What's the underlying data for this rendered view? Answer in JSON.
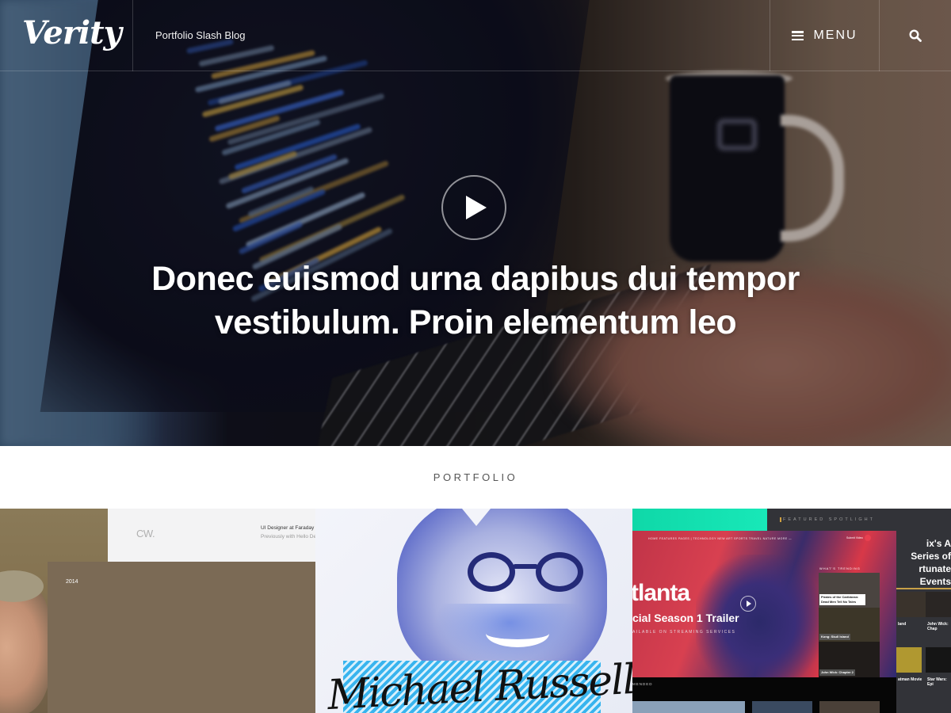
{
  "header": {
    "logo": "Verity",
    "tagline": "Portfolio Slash Blog",
    "menu_label": "MENU",
    "menu_icon": "hamburger-icon",
    "search_icon": "search-icon"
  },
  "hero": {
    "play_icon": "play-icon",
    "title": "Donec euismod urna dapibus dui tempor vestibulum. Proin elementum leo"
  },
  "portfolio": {
    "section_label": "PORTFOLIO",
    "items": [
      {
        "logo_text": "CW.",
        "role": "UI Designer at Faraday I",
        "previously": "Previously with Hello De",
        "year": "2014"
      },
      {
        "signature": "Michael Russell"
      },
      {
        "featured_label": "FEATURED SPOTLIGHT",
        "featured_headline_1": "ix's A Series of",
        "featured_headline_2": "rtunate Events",
        "nav": "HOME   FEATURES   PAGES   |   TECHNOLOGY   NEW   ART   SPORTS   TRAVEL   NATURE   MORE —",
        "submit_label": "Submit Video",
        "title": "tlanta",
        "subtitle": "cial Season 1 Trailer",
        "availability": "AILABLE ON STREAMING SERVICES",
        "trending_label": "WHAT'S TRENDING",
        "trending": [
          "Pirates of the Caribbean: Dead Men Tell No Tales",
          "Kong: Skull Island",
          "John Wick: Chapter 2"
        ],
        "side_captions": [
          "land",
          "John Wick: Chap",
          "atman Movie",
          "Star Wars: Epi"
        ],
        "recommended_label": "MENDED"
      }
    ]
  },
  "colors": {
    "header_text": "#ffffff",
    "section_label": "#555555",
    "tile1_panel": "#7b6a55",
    "tile2_accent": "#38b4ee",
    "tile3_red": "#d84050",
    "tile3_teal": "#18e8b8",
    "tile3_gold": "#c8a048"
  }
}
